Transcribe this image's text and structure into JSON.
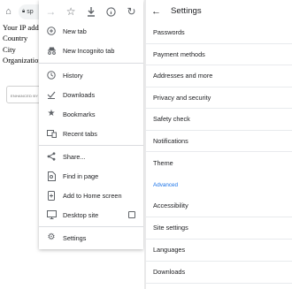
{
  "browser": {
    "url_fragment": "sp",
    "page_lines": [
      "Your IP addr",
      "Country",
      "City",
      "Organization"
    ],
    "ad_label": "ENHANCED BY"
  },
  "menu": {
    "top_icons": [
      "arrow-forward-icon",
      "star-icon",
      "download-icon",
      "info-icon",
      "refresh-icon"
    ],
    "items": [
      {
        "label": "New tab",
        "icon": "new-tab-icon"
      },
      {
        "label": "New Incognito tab",
        "icon": "incognito-icon"
      },
      {
        "label": "History",
        "icon": "history-icon"
      },
      {
        "label": "Downloads",
        "icon": "downloads-icon"
      },
      {
        "label": "Bookmarks",
        "icon": "bookmarks-icon"
      },
      {
        "label": "Recent tabs",
        "icon": "recent-tabs-icon"
      },
      {
        "label": "Share...",
        "icon": "share-icon"
      },
      {
        "label": "Find in page",
        "icon": "find-in-page-icon"
      },
      {
        "label": "Add to Home screen",
        "icon": "add-home-icon"
      },
      {
        "label": "Desktop site",
        "icon": "desktop-icon",
        "checkbox": false
      },
      {
        "label": "Settings",
        "icon": "settings-icon"
      }
    ]
  },
  "settings": {
    "title": "Settings",
    "items": [
      "Passwords",
      "Payment methods",
      "Addresses and more",
      "Privacy and security",
      "Safety check",
      "Notifications",
      "Theme"
    ],
    "advanced_label": "Advanced",
    "advanced_items": [
      "Accessibility",
      "Site settings",
      "Languages",
      "Downloads"
    ]
  },
  "colors": {
    "accent": "#1a73e8",
    "text": "#202124",
    "icon": "#5f6368"
  }
}
